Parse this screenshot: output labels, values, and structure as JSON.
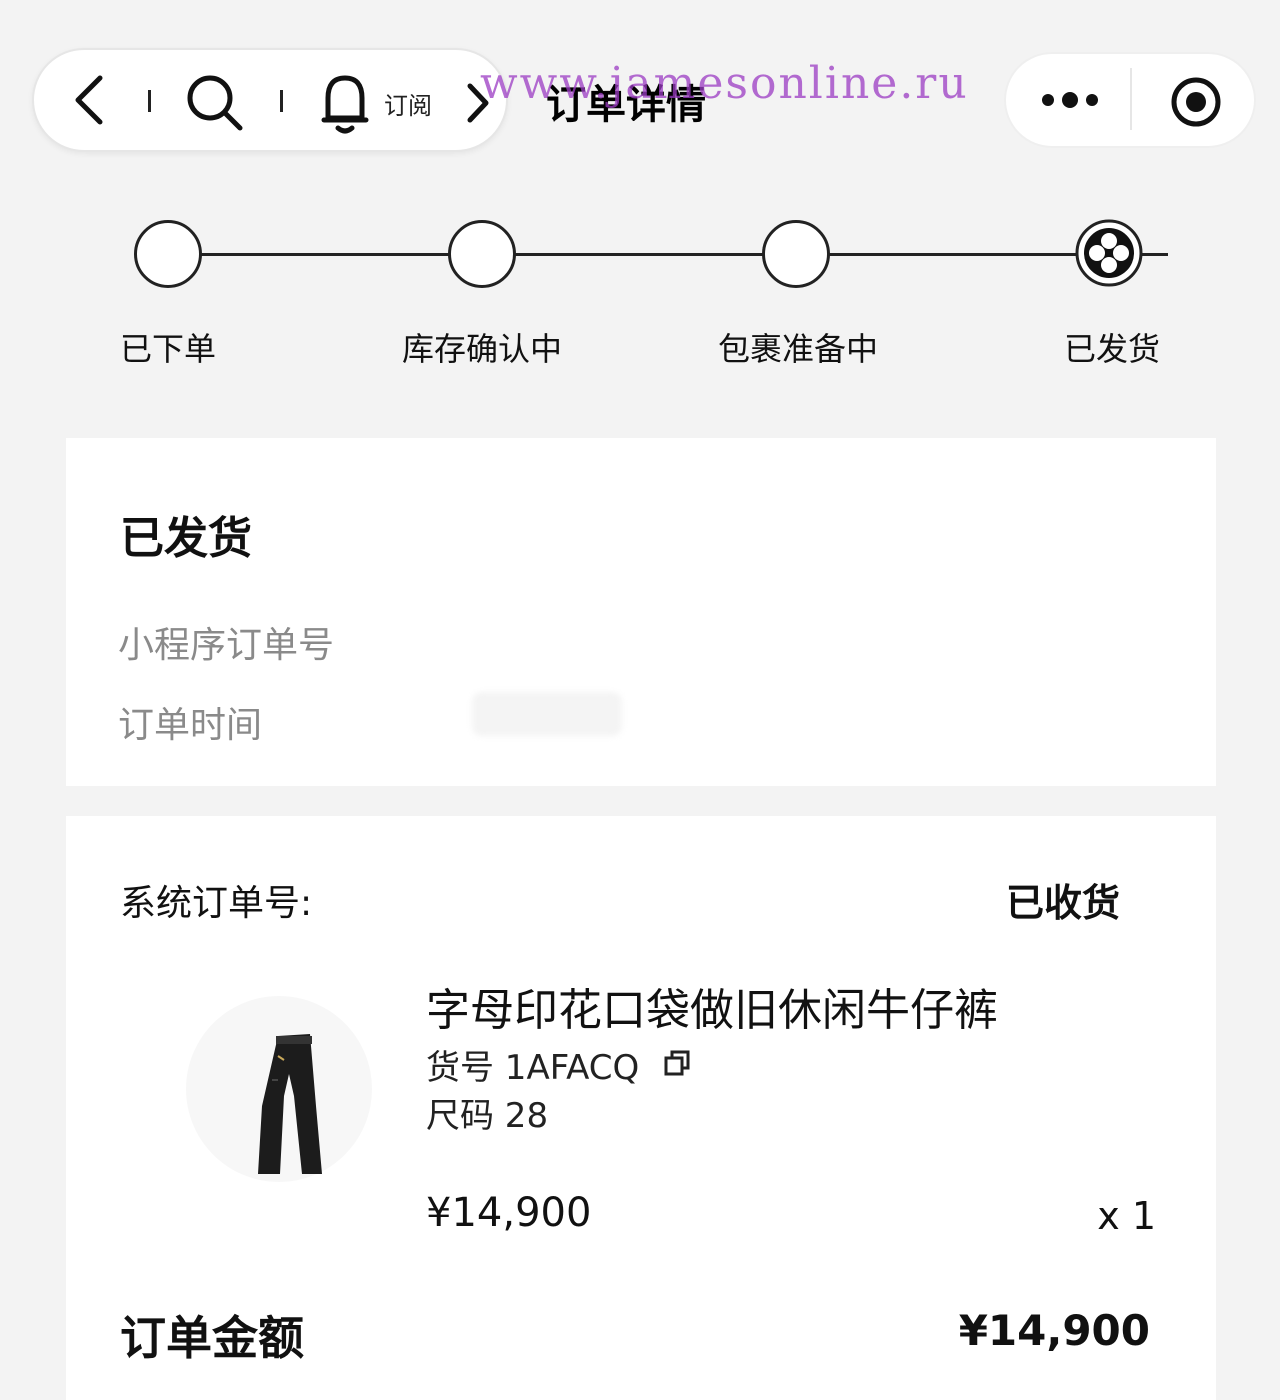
{
  "header": {
    "title": "订单详情",
    "subscribe_label": "订阅",
    "watermark": "www.jamesonline.ru",
    "icons": [
      "back-icon",
      "search-icon",
      "bell-icon",
      "forward-icon",
      "more-dots-icon",
      "record-icon"
    ]
  },
  "stepper": {
    "steps": [
      {
        "label": "已下单",
        "state": "done"
      },
      {
        "label": "库存确认中",
        "state": "done"
      },
      {
        "label": "包裹准备中",
        "state": "done"
      },
      {
        "label": "已发货",
        "state": "current"
      }
    ]
  },
  "order_card": {
    "status": "已发货",
    "mini_program_order_label": "小程序订单号",
    "order_time_label": "订单时间"
  },
  "item_card": {
    "system_order_label": "系统订单号:",
    "status": "已收货",
    "product": {
      "title": "字母印花口袋做旧休闲牛仔裤",
      "sku": "货号 1AFACQ",
      "size": "尺码 28",
      "price": "¥14,900",
      "quantity": "x 1"
    },
    "total_label": "订单金额",
    "total_value": "¥14,900"
  },
  "colors": {
    "accent": "#111111",
    "background": "#f3f3f3",
    "muted": "#8a8a8a",
    "watermark": "#9c3cc4"
  }
}
